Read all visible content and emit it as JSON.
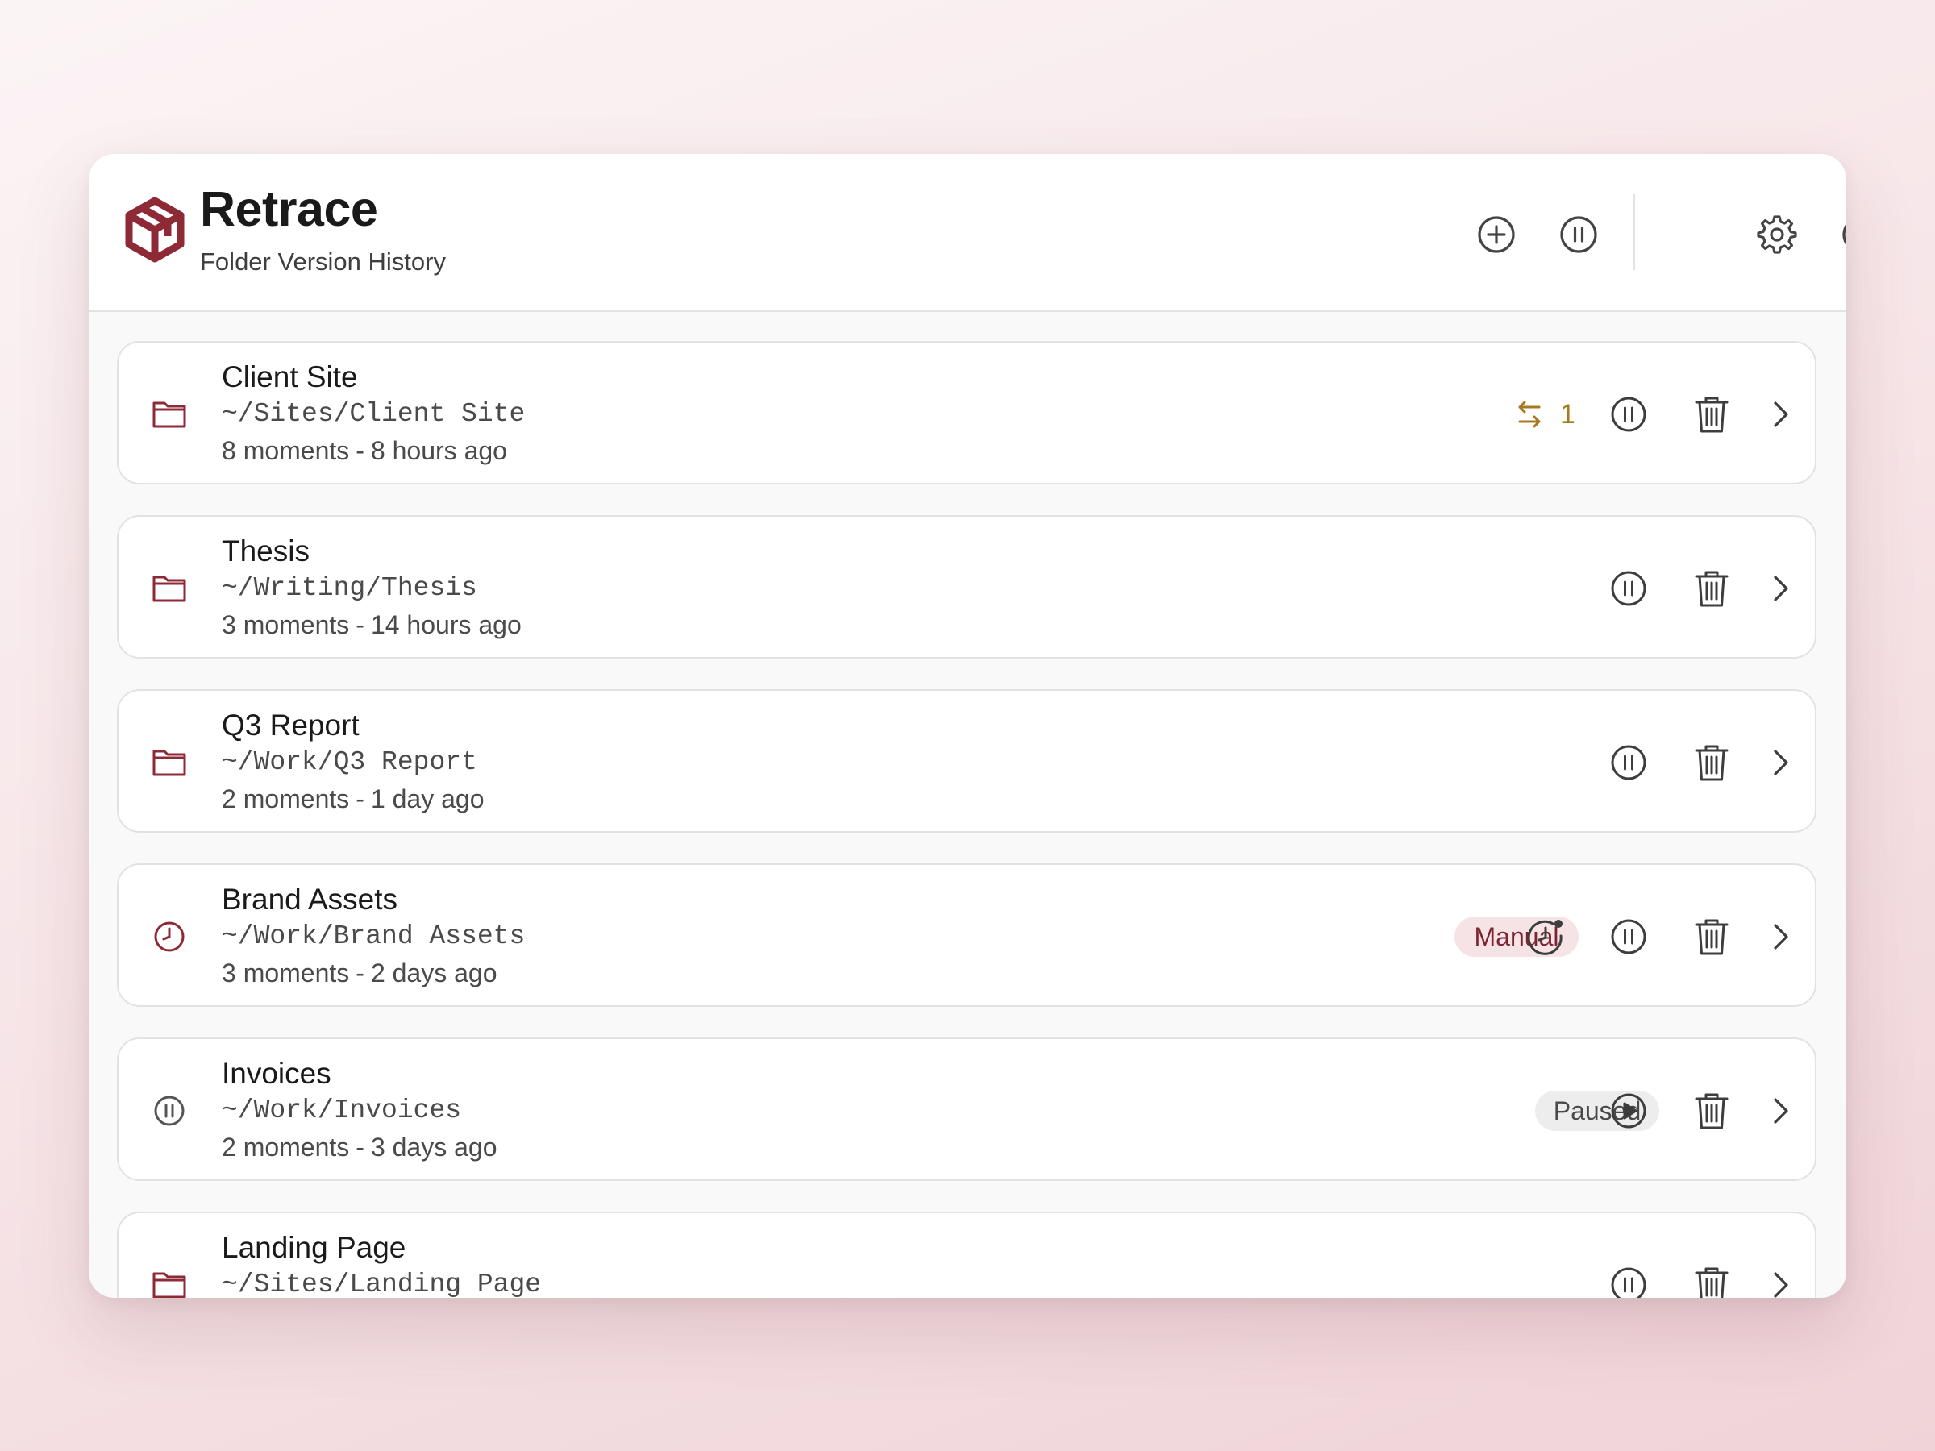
{
  "app": {
    "title": "Retrace",
    "subtitle": "Folder Version History"
  },
  "colors": {
    "brand": "#8e2a35",
    "sync_accent": "#a8791f",
    "manual_badge_bg": "#f6e3e6",
    "manual_badge_text": "#7d2431",
    "paused_badge_bg": "#ededed"
  },
  "header_buttons": [
    {
      "name": "add-folder",
      "icon": "plus-circle-icon"
    },
    {
      "name": "pause-all",
      "icon": "pause-circle-icon"
    },
    {
      "name": "settings",
      "icon": "gear-icon"
    },
    {
      "name": "quit",
      "icon": "power-icon"
    }
  ],
  "folders": [
    {
      "name": "Client Site",
      "path": "~/Sites/Client Site",
      "moments": "8 moments",
      "sep": "-",
      "updated": "8 hours ago",
      "status_icon": "folder-icon",
      "pending_sync": "1",
      "action": "pause"
    },
    {
      "name": "Thesis",
      "path": "~/Writing/Thesis",
      "moments": "3 moments",
      "sep": "-",
      "updated": "14 hours ago",
      "status_icon": "folder-icon",
      "action": "pause"
    },
    {
      "name": "Q3 Report",
      "path": "~/Work/Q3 Report",
      "moments": "2 moments",
      "sep": "-",
      "updated": "1 day ago",
      "status_icon": "folder-icon",
      "action": "pause"
    },
    {
      "name": "Brand Assets",
      "path": "~/Work/Brand Assets",
      "moments": "3 moments",
      "sep": "-",
      "updated": "2 days ago",
      "status_icon": "clock-icon",
      "badge": "Manual",
      "action": "pause"
    },
    {
      "name": "Invoices",
      "path": "~/Work/Invoices",
      "moments": "2 moments",
      "sep": "-",
      "updated": "3 days ago",
      "status_icon": "pause-circle-icon",
      "badge": "Paused",
      "action": "resume"
    },
    {
      "name": "Landing Page",
      "path": "~/Sites/Landing Page",
      "status_icon": "folder-icon",
      "action": "pause"
    }
  ]
}
